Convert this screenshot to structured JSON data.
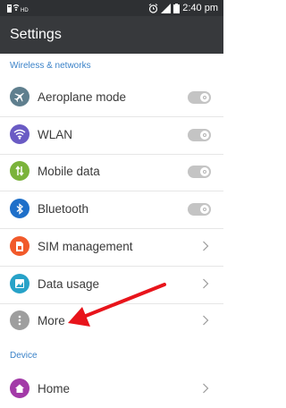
{
  "status_bar": {
    "network_label": "HD",
    "time": "2:40 pm"
  },
  "app_bar": {
    "title": "Settings"
  },
  "sections": {
    "wireless": "Wireless & networks",
    "device": "Device"
  },
  "items": [
    {
      "label": "Aeroplane mode",
      "icon": "airplane-icon",
      "color": "#5f7f8e",
      "control": "toggle",
      "state": "off"
    },
    {
      "label": "WLAN",
      "icon": "wifi-icon",
      "color": "#6a5bc4",
      "control": "toggle",
      "state": "off"
    },
    {
      "label": "Mobile data",
      "icon": "mobile-data-icon",
      "color": "#7bb33b",
      "control": "toggle",
      "state": "off"
    },
    {
      "label": "Bluetooth",
      "icon": "bluetooth-icon",
      "color": "#1e6fc9",
      "control": "toggle",
      "state": "off"
    },
    {
      "label": "SIM management",
      "icon": "sim-card-icon",
      "color": "#f15a2b",
      "control": "chevron"
    },
    {
      "label": "Data usage",
      "icon": "data-usage-icon",
      "color": "#27a2c8",
      "control": "chevron"
    },
    {
      "label": "More",
      "icon": "more-dots-icon",
      "color": "#9e9e9e",
      "control": "chevron"
    },
    {
      "label": "Home",
      "icon": "home-icon",
      "color": "#a33aa8",
      "control": "chevron"
    }
  ],
  "annotation": {
    "color": "#e8141b"
  },
  "colors": {
    "section_header": "#3a82c8",
    "app_bar": "#37393c",
    "status_bar": "#2e3033"
  }
}
